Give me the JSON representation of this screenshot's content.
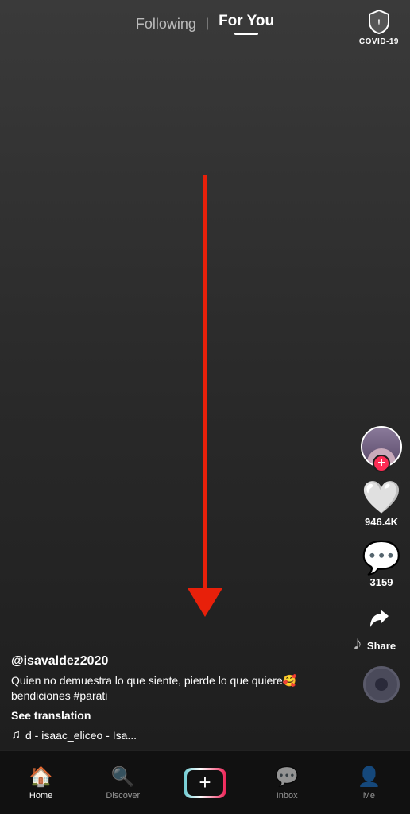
{
  "nav": {
    "following_label": "Following",
    "for_you_label": "For You",
    "covid_label": "COVID-19"
  },
  "actions": {
    "like_count": "946.4K",
    "comment_count": "3159",
    "share_label": "Share"
  },
  "video": {
    "username": "@isavaldez2020",
    "caption": "Quien no demuestra lo que siente, pierde lo que quiere🥰 bendiciones #parati",
    "see_translation": "See translation",
    "music_text": "d - isaac_eliceo - Isa..."
  },
  "bottom_nav": {
    "home_label": "Home",
    "discover_label": "Discover",
    "inbox_label": "Inbox",
    "me_label": "Me"
  }
}
